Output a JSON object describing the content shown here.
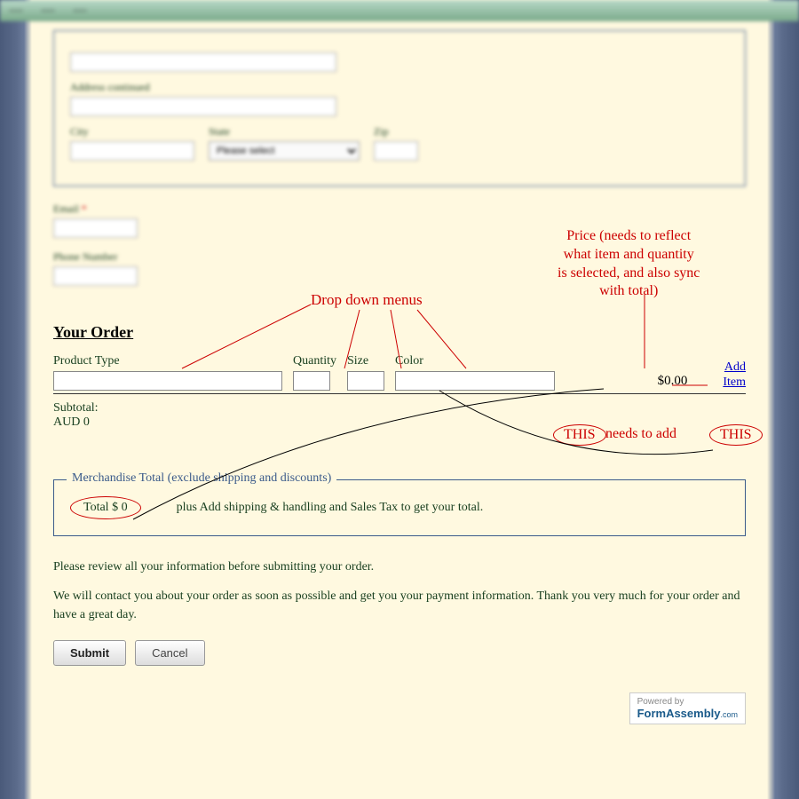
{
  "form": {
    "address_continued_label": "Address continued",
    "city_label": "City",
    "state_label": "State",
    "state_placeholder": "Please select",
    "zip_label": "Zip",
    "email_label": "Email",
    "phone_label": "Phone Number"
  },
  "order": {
    "heading": "Your Order",
    "columns": {
      "product": "Product Type",
      "quantity": "Quantity",
      "size": "Size",
      "color": "Color"
    },
    "price_display": "$0.00",
    "add_item_line1": "Add",
    "add_item_line2": "Item",
    "subtotal_label": "Subtotal:",
    "subtotal_value": "AUD 0"
  },
  "merch": {
    "legend": "Merchandise Total (exclude shipping and discounts)",
    "total_label": "Total $",
    "total_value": "0",
    "note": "plus Add shipping & handling and Sales Tax to get your total."
  },
  "notices": {
    "review": "Please review all your information before submitting your order.",
    "contact": "We will contact you about your order as soon as possible and get you your payment information. Thank you very much for your order and have a great day."
  },
  "buttons": {
    "submit": "Submit",
    "cancel": "Cancel"
  },
  "footer": {
    "powered_by": "Powered by",
    "brand": "FormAssembly",
    "ext": ".com"
  },
  "annotations": {
    "dropdown": "Drop down menus",
    "price": "Price (needs to reflect\nwhat item and quantity\nis selected, and also sync\nwith total)",
    "this": "THIS",
    "needs_add": "needs to add"
  }
}
